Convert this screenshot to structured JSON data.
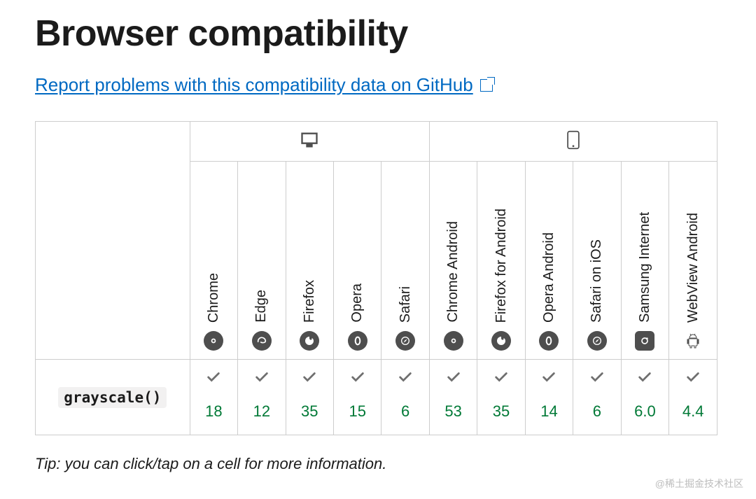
{
  "heading": "Browser compatibility",
  "report_link": "Report problems with this compatibility data on GitHub",
  "tip": "Tip: you can click/tap on a cell for more information.",
  "watermark": "@稀土掘金技术社区",
  "platforms": {
    "desktop": "desktop",
    "mobile": "mobile"
  },
  "browsers": [
    {
      "id": "chrome",
      "name": "Chrome",
      "platform": "desktop"
    },
    {
      "id": "edge",
      "name": "Edge",
      "platform": "desktop"
    },
    {
      "id": "firefox",
      "name": "Firefox",
      "platform": "desktop"
    },
    {
      "id": "opera",
      "name": "Opera",
      "platform": "desktop"
    },
    {
      "id": "safari",
      "name": "Safari",
      "platform": "desktop"
    },
    {
      "id": "chrome_android",
      "name": "Chrome Android",
      "platform": "mobile"
    },
    {
      "id": "firefox_android",
      "name": "Firefox for Android",
      "platform": "mobile"
    },
    {
      "id": "opera_android",
      "name": "Opera Android",
      "platform": "mobile"
    },
    {
      "id": "safari_ios",
      "name": "Safari on iOS",
      "platform": "mobile"
    },
    {
      "id": "samsung",
      "name": "Samsung Internet",
      "platform": "mobile"
    },
    {
      "id": "webview",
      "name": "WebView Android",
      "platform": "mobile"
    }
  ],
  "feature": {
    "name": "grayscale()",
    "support": {
      "chrome": {
        "supported": true,
        "version": "18"
      },
      "edge": {
        "supported": true,
        "version": "12"
      },
      "firefox": {
        "supported": true,
        "version": "35"
      },
      "opera": {
        "supported": true,
        "version": "15"
      },
      "safari": {
        "supported": true,
        "version": "6"
      },
      "chrome_android": {
        "supported": true,
        "version": "53"
      },
      "firefox_android": {
        "supported": true,
        "version": "35"
      },
      "opera_android": {
        "supported": true,
        "version": "14"
      },
      "safari_ios": {
        "supported": true,
        "version": "6"
      },
      "samsung": {
        "supported": true,
        "version": "6.0"
      },
      "webview": {
        "supported": true,
        "version": "4.4"
      }
    }
  },
  "chart_data": {
    "type": "table",
    "title": "Browser compatibility — grayscale()",
    "columns": [
      "Chrome",
      "Edge",
      "Firefox",
      "Opera",
      "Safari",
      "Chrome Android",
      "Firefox for Android",
      "Opera Android",
      "Safari on iOS",
      "Samsung Internet",
      "WebView Android"
    ],
    "rows": [
      {
        "feature": "grayscale()",
        "values": [
          "18",
          "12",
          "35",
          "15",
          "6",
          "53",
          "35",
          "14",
          "6",
          "6.0",
          "4.4"
        ]
      }
    ]
  }
}
